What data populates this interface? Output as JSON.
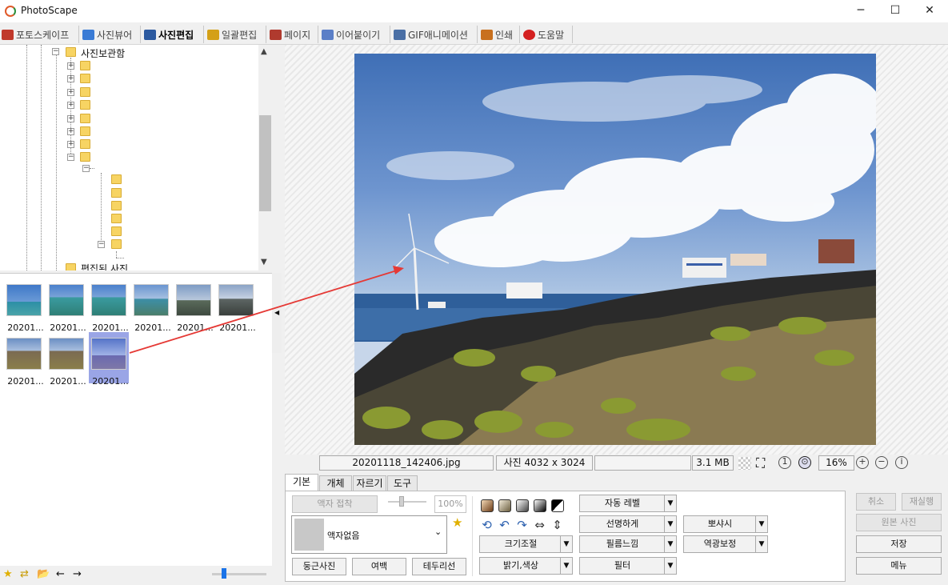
{
  "window": {
    "title": "PhotoScape",
    "minimize": "─",
    "maximize": "☐",
    "close": "✕"
  },
  "menu": [
    {
      "label": "포토스케이프",
      "icon": "photoscape-icon",
      "color": "#c0392b"
    },
    {
      "label": "사진뷰어",
      "icon": "viewer-icon",
      "color": "#3a7bd5"
    },
    {
      "label": "사진편집",
      "icon": "editor-icon",
      "color": "#2c5aa0"
    },
    {
      "label": "일괄편집",
      "icon": "batch-icon",
      "color": "#d4a017"
    },
    {
      "label": "페이지",
      "icon": "page-icon",
      "color": "#b03a2e"
    },
    {
      "label": "이어붙이기",
      "icon": "combine-icon",
      "color": "#5b7fc7"
    },
    {
      "label": "GIF애니메이션",
      "icon": "gif-icon",
      "color": "#4a6fa5"
    },
    {
      "label": "인쇄",
      "icon": "print-icon",
      "color": "#c8701e"
    },
    {
      "label": "도움말",
      "icon": "help-icon",
      "color": "#d42020"
    }
  ],
  "tree": {
    "root_label": "사진보관함",
    "last_label": "편집된 사진"
  },
  "thumbnails": [
    {
      "name": "20201..."
    },
    {
      "name": "20201..."
    },
    {
      "name": "20201..."
    },
    {
      "name": "20201..."
    },
    {
      "name": "20201..."
    },
    {
      "name": "20201..."
    },
    {
      "name": "20201..."
    },
    {
      "name": "20201..."
    },
    {
      "name": "20201..."
    }
  ],
  "status": {
    "filename": "20201118_142406.jpg",
    "dimensions": "사진 4032 x 3024",
    "blank": "",
    "size": "3.1 MB",
    "zoom": "16%"
  },
  "tabs": [
    "기본",
    "개체",
    "자르기",
    "도구"
  ],
  "panel": {
    "frame_apply": "액자 접착",
    "frame_percent": "100%",
    "frame_select": "액자없음",
    "round_photo": "둥근사진",
    "margin": "여백",
    "border": "테두리선",
    "resize": "크기조절",
    "brightness": "밝기,색상",
    "auto_level": "자동 레벨",
    "sharpen": "선명하게",
    "film": "필름느낌",
    "filter": "필터",
    "bloom": "뽀샤시",
    "backlight": "역광보정"
  },
  "actions": {
    "undo": "취소",
    "redo": "재실행",
    "original": "원본 사진",
    "save": "저장",
    "menu": "메뉴"
  }
}
